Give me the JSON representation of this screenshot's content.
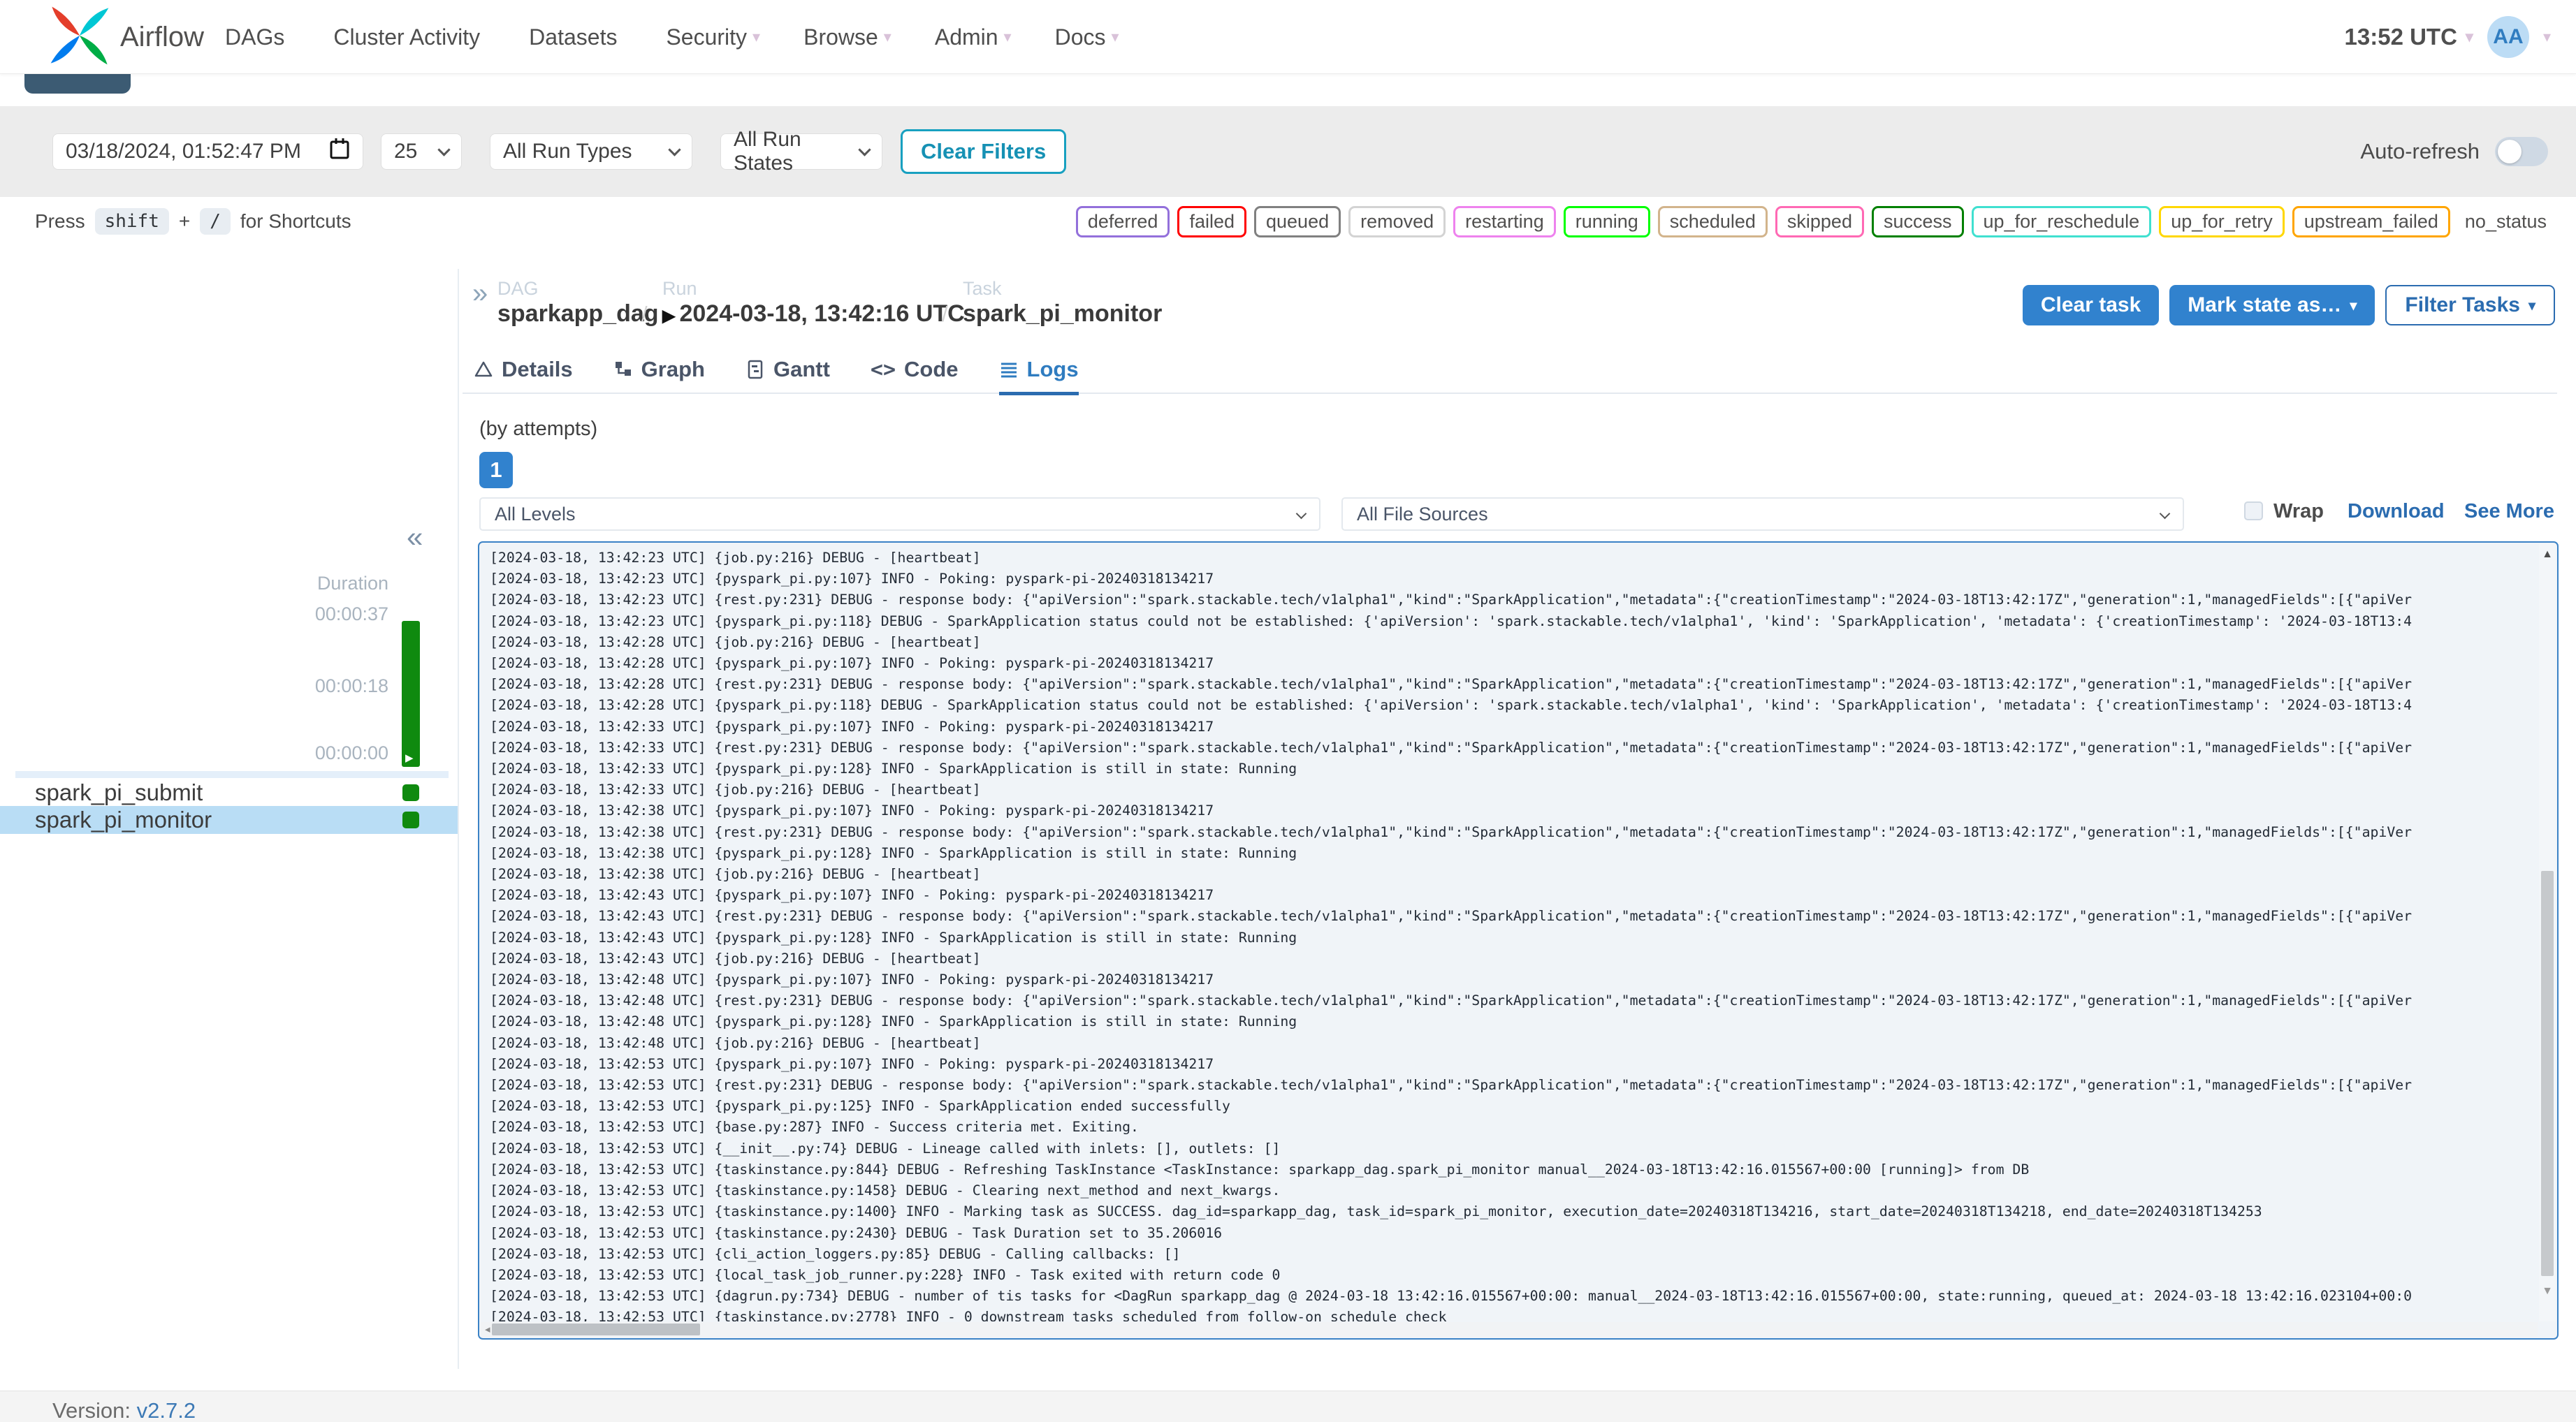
{
  "colors": {
    "accent": "#3182ce",
    "success_green": "#008000",
    "selected_row": "#b9ddf5",
    "clear_filters_teal": "#18a0c0",
    "log_border": "#3b82c6"
  },
  "navbar": {
    "brand": "Airflow",
    "items": [
      {
        "label": "DAGs",
        "caret": ""
      },
      {
        "label": "Cluster Activity",
        "caret": ""
      },
      {
        "label": "Datasets",
        "caret": ""
      },
      {
        "label": "Security",
        "caret": "▾"
      },
      {
        "label": "Browse",
        "caret": "▾"
      },
      {
        "label": "Admin",
        "caret": "▾"
      },
      {
        "label": "Docs",
        "caret": "▾"
      }
    ],
    "clock": "13:52 UTC",
    "avatar_initials": "AA"
  },
  "filters": {
    "date_value": "03/18/2024, 01:52:47 PM",
    "page_size": "25",
    "run_types": "All Run Types",
    "run_states": "All Run States",
    "clear_label": "Clear Filters",
    "auto_refresh_label": "Auto-refresh"
  },
  "shortcuts": {
    "press": "Press",
    "key1": "shift",
    "plus": "+",
    "key2": "/",
    "suffix": "for Shortcuts"
  },
  "state_badges": [
    {
      "label": "deferred",
      "color": "#9370db"
    },
    {
      "label": "failed",
      "color": "#ff0000"
    },
    {
      "label": "queued",
      "color": "#808080"
    },
    {
      "label": "removed",
      "color": "#d3d3d3"
    },
    {
      "label": "restarting",
      "color": "#ee82ee"
    },
    {
      "label": "running",
      "color": "#00ff00"
    },
    {
      "label": "scheduled",
      "color": "#d2b48c"
    },
    {
      "label": "skipped",
      "color": "#ff69b4"
    },
    {
      "label": "success",
      "color": "#008000"
    },
    {
      "label": "up_for_reschedule",
      "color": "#40e0d0"
    },
    {
      "label": "up_for_retry",
      "color": "#ffd700"
    },
    {
      "label": "upstream_failed",
      "color": "#ffa500"
    }
  ],
  "no_status_label": "no_status",
  "sidebar": {
    "collapse_icon": "«",
    "duration_label": "Duration",
    "ticks": [
      "00:00:37",
      "00:00:18",
      "00:00:00"
    ],
    "tasks": [
      {
        "name": "spark_pi_submit"
      },
      {
        "name": "spark_pi_monitor"
      }
    ]
  },
  "breadcrumb": {
    "expand_icon": "»",
    "dag_label": "DAG",
    "dag": "sparkapp_dag",
    "run_label": "Run",
    "run": "2024-03-18, 13:42:16 UTC",
    "task_label": "Task",
    "task": "spark_pi_monitor",
    "separator": "/"
  },
  "actions": {
    "clear_task": "Clear task",
    "mark_state": "Mark state as…",
    "filter_tasks": "Filter Tasks"
  },
  "tabs": [
    {
      "label": "Details"
    },
    {
      "label": "Graph"
    },
    {
      "label": "Gantt"
    },
    {
      "label": "Code"
    },
    {
      "label": "Logs"
    }
  ],
  "log": {
    "by_attempts_label": "(by attempts)",
    "attempt": "1",
    "levels_filter": "All Levels",
    "sources_filter": "All File Sources",
    "wrap_label": "Wrap",
    "download_label": "Download",
    "see_more_label": "See More",
    "lines": [
      "[2024-03-18, 13:42:23 UTC] {job.py:216} DEBUG - [heartbeat]",
      "[2024-03-18, 13:42:23 UTC] {pyspark_pi.py:107} INFO - Poking: pyspark-pi-20240318134217",
      "[2024-03-18, 13:42:23 UTC] {rest.py:231} DEBUG - response body: {\"apiVersion\":\"spark.stackable.tech/v1alpha1\",\"kind\":\"SparkApplication\",\"metadata\":{\"creationTimestamp\":\"2024-03-18T13:42:17Z\",\"generation\":1,\"managedFields\":[{\"apiVer",
      "[2024-03-18, 13:42:23 UTC] {pyspark_pi.py:118} DEBUG - SparkApplication status could not be established: {'apiVersion': 'spark.stackable.tech/v1alpha1', 'kind': 'SparkApplication', 'metadata': {'creationTimestamp': '2024-03-18T13:4",
      "[2024-03-18, 13:42:28 UTC] {job.py:216} DEBUG - [heartbeat]",
      "[2024-03-18, 13:42:28 UTC] {pyspark_pi.py:107} INFO - Poking: pyspark-pi-20240318134217",
      "[2024-03-18, 13:42:28 UTC] {rest.py:231} DEBUG - response body: {\"apiVersion\":\"spark.stackable.tech/v1alpha1\",\"kind\":\"SparkApplication\",\"metadata\":{\"creationTimestamp\":\"2024-03-18T13:42:17Z\",\"generation\":1,\"managedFields\":[{\"apiVer",
      "[2024-03-18, 13:42:28 UTC] {pyspark_pi.py:118} DEBUG - SparkApplication status could not be established: {'apiVersion': 'spark.stackable.tech/v1alpha1', 'kind': 'SparkApplication', 'metadata': {'creationTimestamp': '2024-03-18T13:4",
      "[2024-03-18, 13:42:33 UTC] {pyspark_pi.py:107} INFO - Poking: pyspark-pi-20240318134217",
      "[2024-03-18, 13:42:33 UTC] {rest.py:231} DEBUG - response body: {\"apiVersion\":\"spark.stackable.tech/v1alpha1\",\"kind\":\"SparkApplication\",\"metadata\":{\"creationTimestamp\":\"2024-03-18T13:42:17Z\",\"generation\":1,\"managedFields\":[{\"apiVer",
      "[2024-03-18, 13:42:33 UTC] {pyspark_pi.py:128} INFO - SparkApplication is still in state: Running",
      "[2024-03-18, 13:42:33 UTC] {job.py:216} DEBUG - [heartbeat]",
      "[2024-03-18, 13:42:38 UTC] {pyspark_pi.py:107} INFO - Poking: pyspark-pi-20240318134217",
      "[2024-03-18, 13:42:38 UTC] {rest.py:231} DEBUG - response body: {\"apiVersion\":\"spark.stackable.tech/v1alpha1\",\"kind\":\"SparkApplication\",\"metadata\":{\"creationTimestamp\":\"2024-03-18T13:42:17Z\",\"generation\":1,\"managedFields\":[{\"apiVer",
      "[2024-03-18, 13:42:38 UTC] {pyspark_pi.py:128} INFO - SparkApplication is still in state: Running",
      "[2024-03-18, 13:42:38 UTC] {job.py:216} DEBUG - [heartbeat]",
      "[2024-03-18, 13:42:43 UTC] {pyspark_pi.py:107} INFO - Poking: pyspark-pi-20240318134217",
      "[2024-03-18, 13:42:43 UTC] {rest.py:231} DEBUG - response body: {\"apiVersion\":\"spark.stackable.tech/v1alpha1\",\"kind\":\"SparkApplication\",\"metadata\":{\"creationTimestamp\":\"2024-03-18T13:42:17Z\",\"generation\":1,\"managedFields\":[{\"apiVer",
      "[2024-03-18, 13:42:43 UTC] {pyspark_pi.py:128} INFO - SparkApplication is still in state: Running",
      "[2024-03-18, 13:42:43 UTC] {job.py:216} DEBUG - [heartbeat]",
      "[2024-03-18, 13:42:48 UTC] {pyspark_pi.py:107} INFO - Poking: pyspark-pi-20240318134217",
      "[2024-03-18, 13:42:48 UTC] {rest.py:231} DEBUG - response body: {\"apiVersion\":\"spark.stackable.tech/v1alpha1\",\"kind\":\"SparkApplication\",\"metadata\":{\"creationTimestamp\":\"2024-03-18T13:42:17Z\",\"generation\":1,\"managedFields\":[{\"apiVer",
      "[2024-03-18, 13:42:48 UTC] {pyspark_pi.py:128} INFO - SparkApplication is still in state: Running",
      "[2024-03-18, 13:42:48 UTC] {job.py:216} DEBUG - [heartbeat]",
      "[2024-03-18, 13:42:53 UTC] {pyspark_pi.py:107} INFO - Poking: pyspark-pi-20240318134217",
      "[2024-03-18, 13:42:53 UTC] {rest.py:231} DEBUG - response body: {\"apiVersion\":\"spark.stackable.tech/v1alpha1\",\"kind\":\"SparkApplication\",\"metadata\":{\"creationTimestamp\":\"2024-03-18T13:42:17Z\",\"generation\":1,\"managedFields\":[{\"apiVer",
      "[2024-03-18, 13:42:53 UTC] {pyspark_pi.py:125} INFO - SparkApplication ended successfully",
      "[2024-03-18, 13:42:53 UTC] {base.py:287} INFO - Success criteria met. Exiting.",
      "[2024-03-18, 13:42:53 UTC] {__init__.py:74} DEBUG - Lineage called with inlets: [], outlets: []",
      "[2024-03-18, 13:42:53 UTC] {taskinstance.py:844} DEBUG - Refreshing TaskInstance <TaskInstance: sparkapp_dag.spark_pi_monitor manual__2024-03-18T13:42:16.015567+00:00 [running]> from DB",
      "[2024-03-18, 13:42:53 UTC] {taskinstance.py:1458} DEBUG - Clearing next_method and next_kwargs.",
      "[2024-03-18, 13:42:53 UTC] {taskinstance.py:1400} INFO - Marking task as SUCCESS. dag_id=sparkapp_dag, task_id=spark_pi_monitor, execution_date=20240318T134216, start_date=20240318T134218, end_date=20240318T134253",
      "[2024-03-18, 13:42:53 UTC] {taskinstance.py:2430} DEBUG - Task Duration set to 35.206016",
      "[2024-03-18, 13:42:53 UTC] {cli_action_loggers.py:85} DEBUG - Calling callbacks: []",
      "[2024-03-18, 13:42:53 UTC] {local_task_job_runner.py:228} INFO - Task exited with return code 0",
      "[2024-03-18, 13:42:53 UTC] {dagrun.py:734} DEBUG - number of tis tasks for <DagRun sparkapp_dag @ 2024-03-18 13:42:16.015567+00:00: manual__2024-03-18T13:42:16.015567+00:00, state:running, queued_at: 2024-03-18 13:42:16.023104+00:0",
      "[2024-03-18, 13:42:53 UTC] {taskinstance.py:2778} INFO - 0 downstream tasks scheduled from follow-on schedule check"
    ]
  },
  "footer": {
    "version_label": "Version:",
    "version": "v2.7.2"
  }
}
